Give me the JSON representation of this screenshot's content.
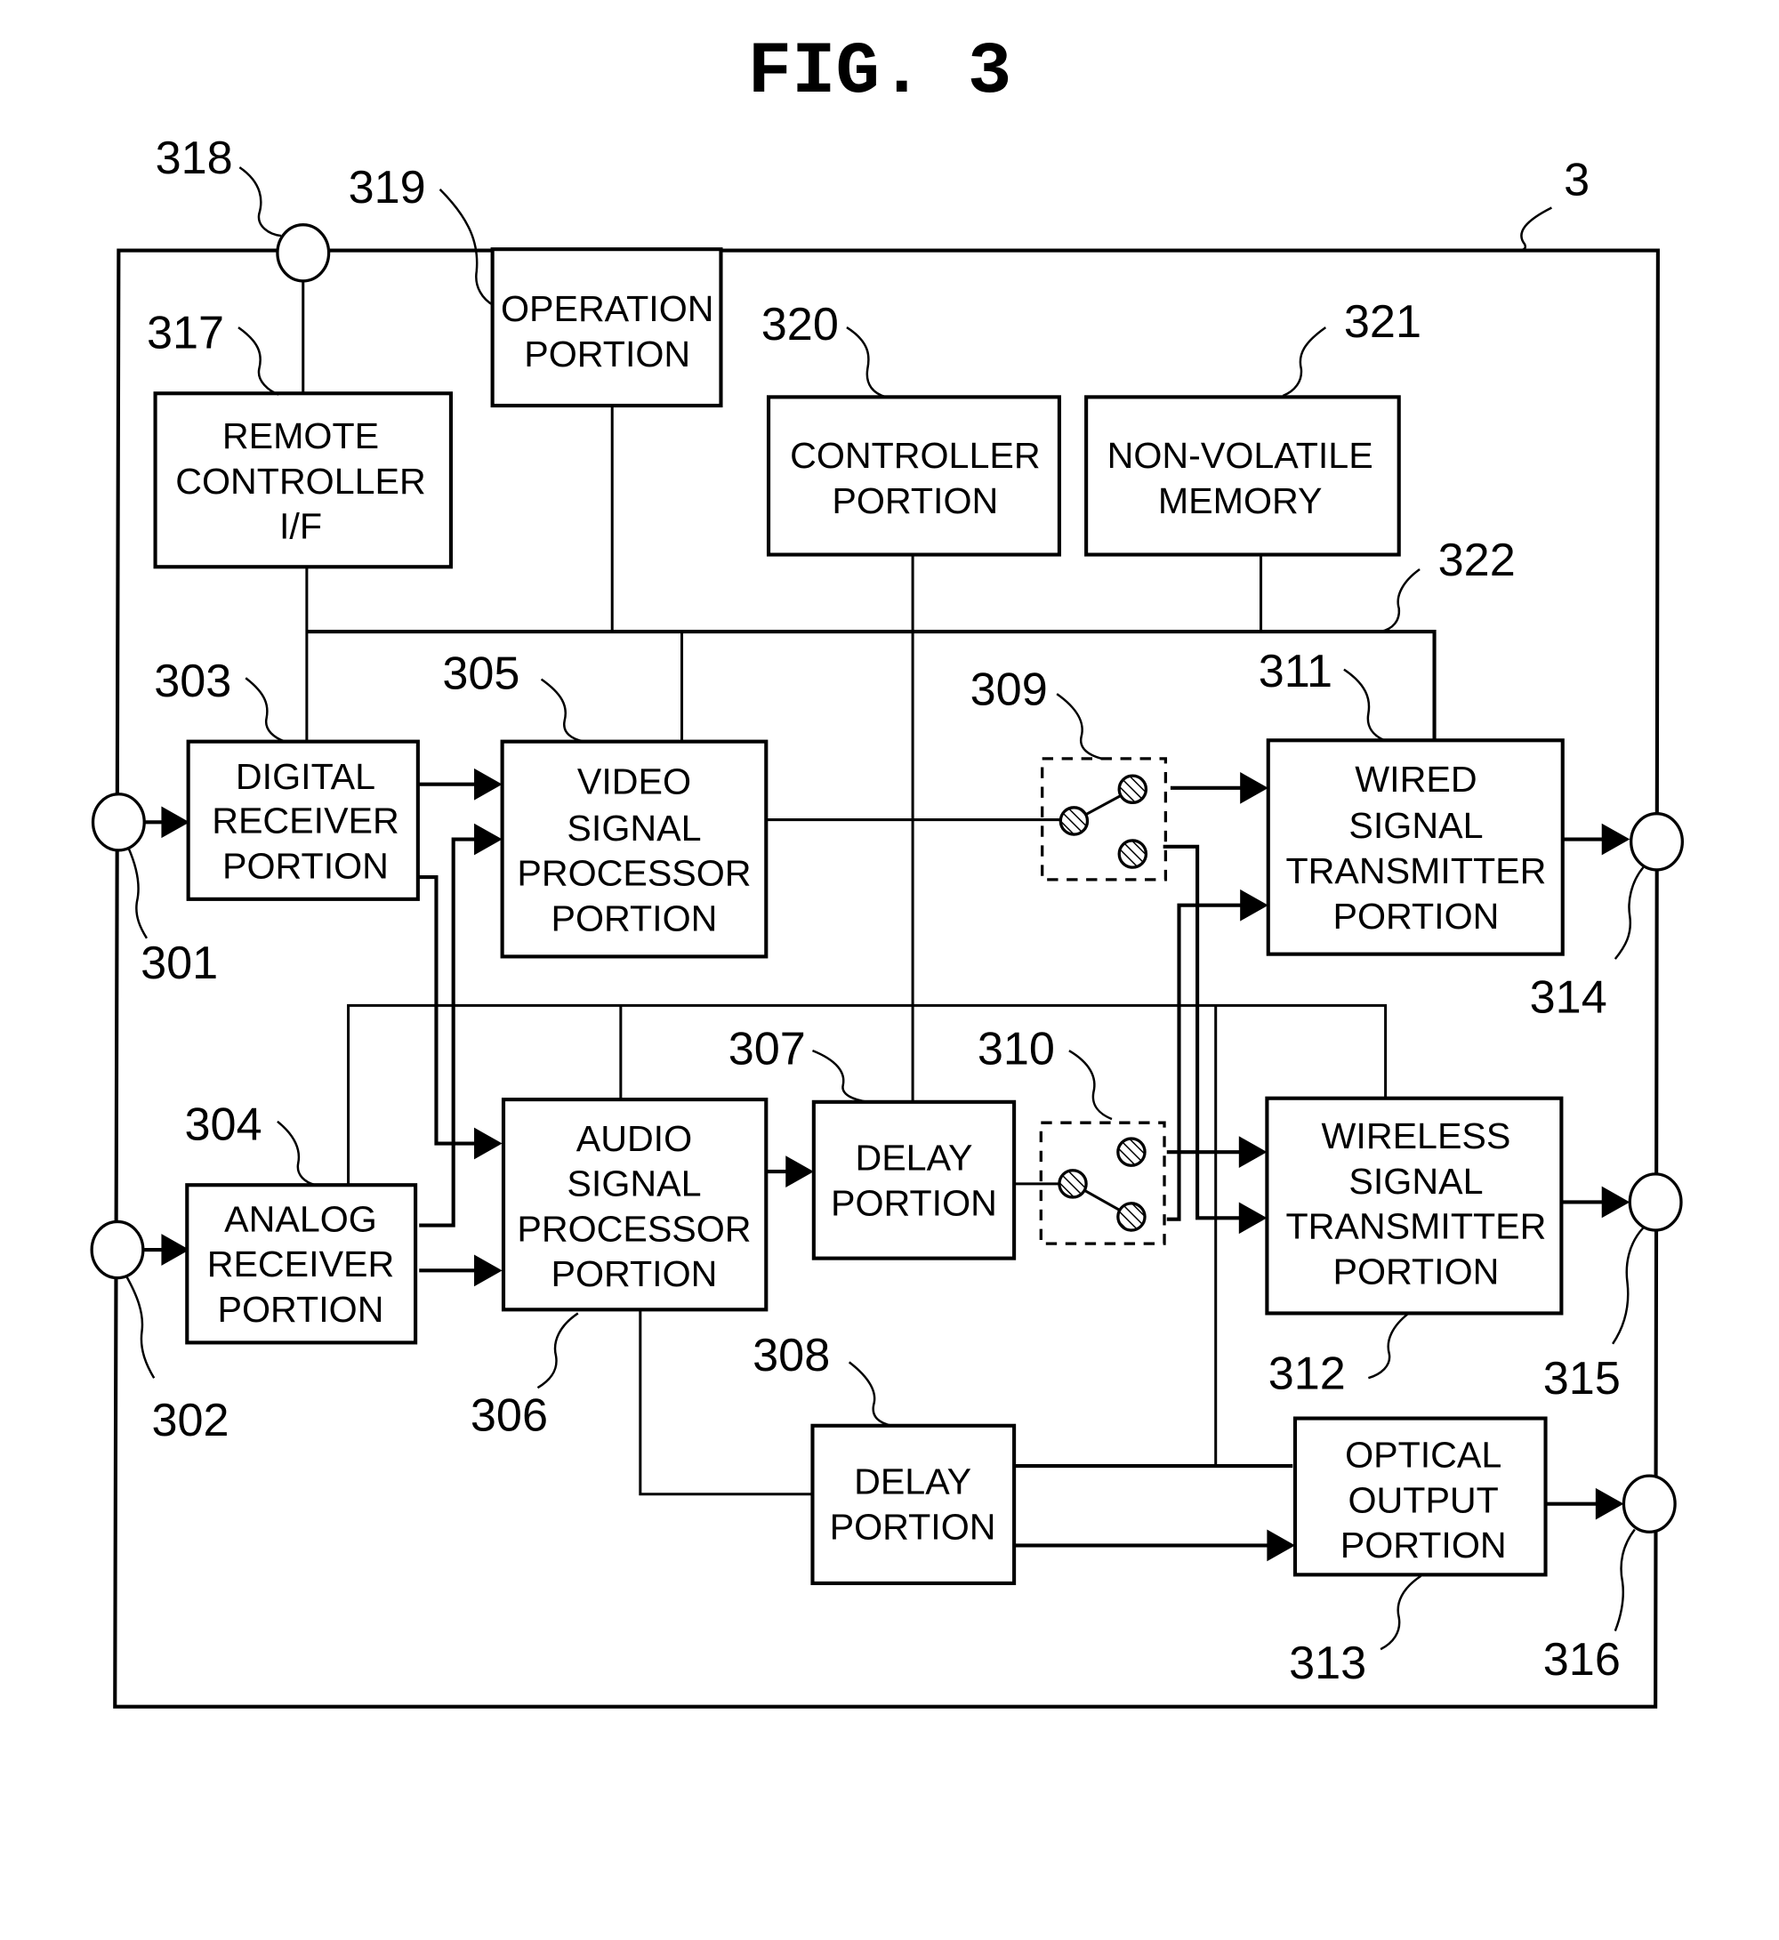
{
  "figure": {
    "title": "FIG. 3",
    "device_ref": "3",
    "bus_ref": "322"
  },
  "blocks": {
    "remote_if": {
      "ref": "317",
      "lines": [
        "REMOTE",
        "CONTROLLER",
        "I/F"
      ]
    },
    "operation": {
      "ref": "319",
      "lines": [
        "OPERATION",
        "PORTION"
      ]
    },
    "controller": {
      "ref": "320",
      "lines": [
        "CONTROLLER",
        "PORTION"
      ]
    },
    "nvmem": {
      "ref": "321",
      "lines": [
        "NON-VOLATILE",
        "MEMORY"
      ]
    },
    "digital_rx": {
      "ref": "303",
      "lines": [
        "DIGITAL",
        "RECEIVER",
        "PORTION"
      ]
    },
    "video_proc": {
      "ref": "305",
      "lines": [
        "VIDEO",
        "SIGNAL",
        "PROCESSOR",
        "PORTION"
      ]
    },
    "analog_rx": {
      "ref": "304",
      "lines": [
        "ANALOG",
        "RECEIVER",
        "PORTION"
      ]
    },
    "audio_proc": {
      "ref": "306",
      "lines": [
        "AUDIO",
        "SIGNAL",
        "PROCESSOR",
        "PORTION"
      ]
    },
    "delay_307": {
      "ref": "307",
      "lines": [
        "DELAY",
        "PORTION"
      ]
    },
    "delay_308": {
      "ref": "308",
      "lines": [
        "DELAY",
        "PORTION"
      ]
    },
    "wired_tx": {
      "ref": "311",
      "lines": [
        "WIRED",
        "SIGNAL",
        "TRANSMITTER",
        "PORTION"
      ]
    },
    "wireless_tx": {
      "ref": "312",
      "lines": [
        "WIRELESS",
        "SIGNAL",
        "TRANSMITTER",
        "PORTION"
      ]
    },
    "optical_out": {
      "ref": "313",
      "lines": [
        "OPTICAL",
        "OUTPUT",
        "PORTION"
      ]
    }
  },
  "switches": {
    "sw_309": {
      "ref": "309"
    },
    "sw_310": {
      "ref": "310"
    }
  },
  "terminals": {
    "remote_jack": {
      "ref": "318"
    },
    "digital_in": {
      "ref": "301"
    },
    "analog_in": {
      "ref": "302"
    },
    "wired_out": {
      "ref": "314"
    },
    "wireless_out": {
      "ref": "315"
    },
    "optical_jack": {
      "ref": "316"
    }
  }
}
